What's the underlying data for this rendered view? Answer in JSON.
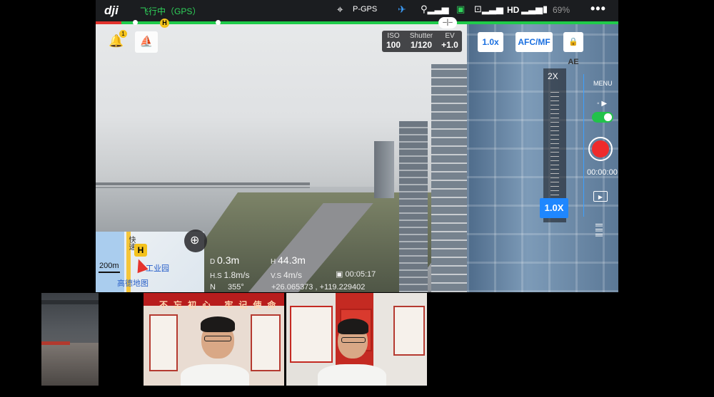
{
  "topbar": {
    "logo": "dji",
    "flight_status": "飞行中（GPS）",
    "gps_mode": "P-GPS",
    "hd_label": "HD",
    "battery": "69%",
    "more_icon": "more-icon"
  },
  "camera": {
    "iso_label": "ISO",
    "iso_value": "100",
    "shutter_label": "Shutter",
    "shutter_value": "1/120",
    "ev_label": "EV",
    "ev_value": "+1.0",
    "zoom_badge": "1.0x",
    "focus_mode": "AFC/MF",
    "ae_lock": "AE",
    "zoom_max": "2X",
    "zoom_current": "1.0X",
    "menu": "MENU",
    "record_time": "00:00:00",
    "colors": {
      "accent": "#1f87ff",
      "record": "#ee2b2b",
      "progress": "#1fcb4a"
    }
  },
  "telemetry": {
    "d_label": "D",
    "d_value": "0.3m",
    "h_label": "H",
    "h_value": "44.3m",
    "hs_label": "H.S",
    "hs_value": "1.8m/s",
    "vs_label": "V.S",
    "vs_value": "4m/s",
    "flight_time": "00:05:17",
    "heading_label": "N",
    "heading_value": "355°",
    "coords": "+26.065373 , +119.229402"
  },
  "map": {
    "scale": "200m",
    "road_label": "快速",
    "home_marker": "H",
    "poi": "工业园",
    "provider": "高德地图"
  },
  "alerts": {
    "notification_count": "1"
  },
  "participants": {
    "tile2_banner": "不忘初心 牢记使命"
  }
}
